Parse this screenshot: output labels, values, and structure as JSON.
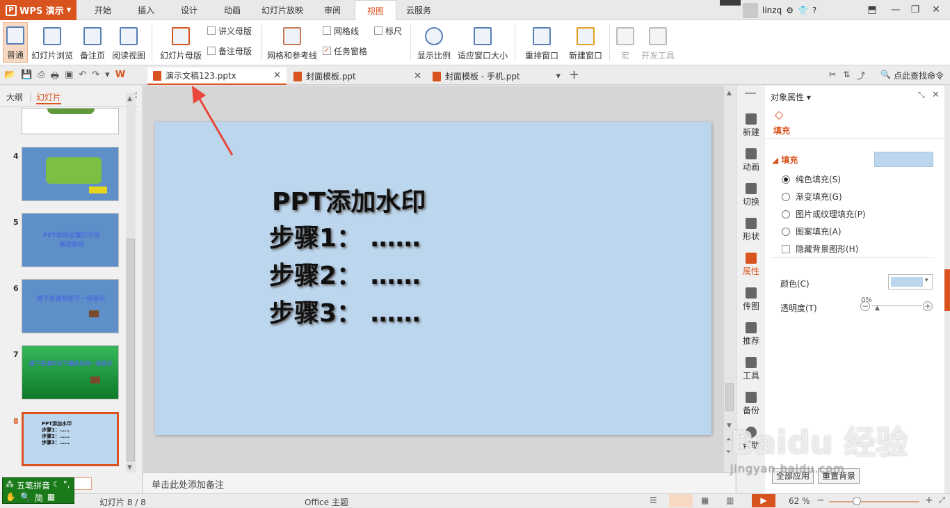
{
  "app": {
    "name": "WPS 演示"
  },
  "menu": {
    "tabs": [
      "开始",
      "插入",
      "设计",
      "动画",
      "幻灯片放映",
      "审阅",
      "视图",
      "云服务"
    ],
    "active": "视图"
  },
  "user": {
    "name": "linzq"
  },
  "ribbon": {
    "normal": "普通",
    "slide_sorter": "幻灯片浏览",
    "notes_page": "备注页",
    "reading_view": "阅读视图",
    "slide_master": "幻灯片母版",
    "handout_master": "讲义母版",
    "notes_master": "备注母版",
    "grid_guides": "网格和参考线",
    "gridlines": "网格线",
    "ruler": "标尺",
    "task_pane": "任务窗格",
    "zoom": "显示比例",
    "fit_window": "适应窗口大小",
    "arrange_windows": "重排窗口",
    "new_window": "新建窗口",
    "macro": "宏",
    "dev_tools": "开发工具"
  },
  "doc_tabs": [
    {
      "title": "演示文稿123.pptx",
      "active": true
    },
    {
      "title": "封面模板.ppt",
      "active": false
    },
    {
      "title": "封面模板 - 手机.ppt",
      "active": false
    }
  ],
  "search": {
    "label": "点此查找命令"
  },
  "left_panel": {
    "tab_outline": "大纲",
    "tab_slides": "幻灯片",
    "thumbnails": [
      {
        "num": "4",
        "text": "",
        "bg": "#5e8fc9"
      },
      {
        "num": "5",
        "text": "PPT如何设置打开及修改密码",
        "bg": "#5e8fc9"
      },
      {
        "num": "6",
        "text": "接下来请听如下一段音乐",
        "bg": "#5e8fc9"
      },
      {
        "num": "7",
        "text": "接下来请听如下播放后的一段音乐",
        "bg": "#1f9a3a"
      },
      {
        "num": "8",
        "text": "PPT添加水印\n步骤1：……\n步骤2：……\n步骤3：……",
        "bg": "#bcd6ee"
      }
    ]
  },
  "slide": {
    "title": "PPT添加水印",
    "lines": [
      "步骤1：  ……",
      "步骤2：  ……",
      "步骤3：  ……"
    ]
  },
  "notes": {
    "placeholder": "单击此处添加备注"
  },
  "side_tabs": [
    "新建",
    "动画",
    "切换",
    "形状",
    "属性",
    "传图",
    "推荐",
    "工具",
    "备份",
    "帮助"
  ],
  "props": {
    "header": "对象属性",
    "tab": "填充",
    "section": "填充",
    "options": [
      "纯色填充(S)",
      "渐变填充(G)",
      "图片或纹理填充(P)",
      "图案填充(A)"
    ],
    "hide_bg": "隐藏背景图形(H)",
    "color_label": "颜色(C)",
    "transparency_label": "透明度(T)",
    "transparency_value": "0%",
    "fill_color": "#bcd6ee",
    "apply_all": "全部应用",
    "reset_bg": "重置背景"
  },
  "status": {
    "slide_pos": "幻灯片 8 / 8",
    "theme": "Office 主题",
    "zoom": "62 %"
  },
  "ime": {
    "name": "五笔拼音",
    "mode": "简"
  },
  "watermark": {
    "text": "Baidu 经验",
    "url": "jingyan.baidu.com"
  }
}
